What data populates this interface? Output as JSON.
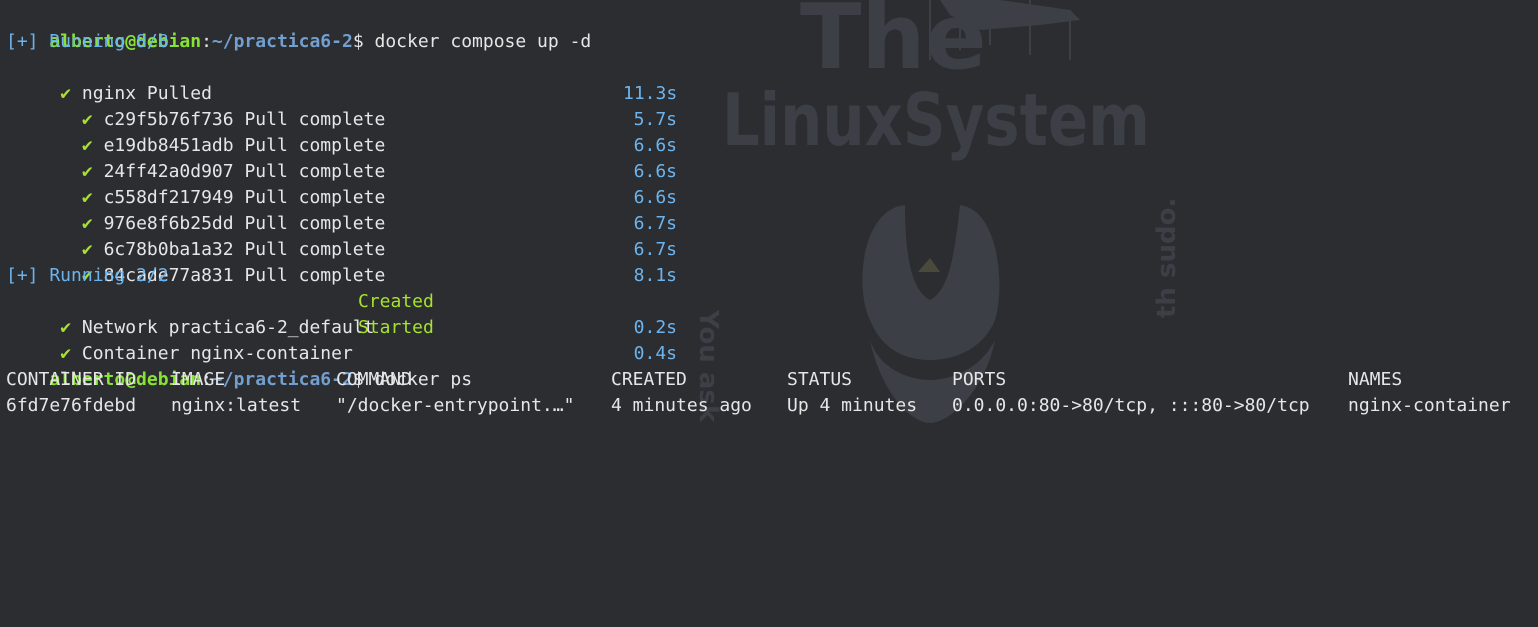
{
  "prompt": {
    "user_host": "alberto@debian",
    "sep1": ":",
    "path": "~/practica6-2",
    "sep2": "$ "
  },
  "commands": [
    "docker compose up -d",
    "docker ps"
  ],
  "section1": {
    "status": "[+] Running 8/8",
    "items": [
      {
        "check": "✔",
        "text": "nginx Pulled",
        "time": "11.3s"
      },
      {
        "check": "✔",
        "text": "c29f5b76f736 Pull complete",
        "time": "5.7s"
      },
      {
        "check": "✔",
        "text": "e19db8451adb Pull complete",
        "time": "6.6s"
      },
      {
        "check": "✔",
        "text": "24ff42a0d907 Pull complete",
        "time": "6.6s"
      },
      {
        "check": "✔",
        "text": "c558df217949 Pull complete",
        "time": "6.6s"
      },
      {
        "check": "✔",
        "text": "976e8f6b25dd Pull complete",
        "time": "6.7s"
      },
      {
        "check": "✔",
        "text": "6c78b0ba1a32 Pull complete",
        "time": "6.7s"
      },
      {
        "check": "✔",
        "text": "84cade77a831 Pull complete",
        "time": "8.1s"
      }
    ]
  },
  "section2": {
    "status": "[+] Running 2/2",
    "items": [
      {
        "check": "✔",
        "text": "Network practica6-2_default",
        "state": "Created",
        "time": "0.2s"
      },
      {
        "check": "✔",
        "text": "Container nginx-container",
        "state": "Started",
        "time": "0.4s"
      }
    ]
  },
  "ps_table": {
    "headers": [
      "CONTAINER ID",
      "IMAGE",
      "COMMAND",
      "CREATED",
      "STATUS",
      "PORTS",
      "NAMES"
    ],
    "rows": [
      [
        "6fd7e76fdebd",
        "nginx:latest",
        "\"/docker-entrypoint.…\"",
        "4 minutes ago",
        "Up 4 minutes",
        "0.0.0.0:80->80/tcp, :::80->80/tcp",
        "nginx-container"
      ]
    ]
  },
  "wallpaper": {
    "title_line1": "The",
    "title_line2": "LinuxSystem",
    "side_left": "You ask",
    "side_right": "th sudo."
  }
}
